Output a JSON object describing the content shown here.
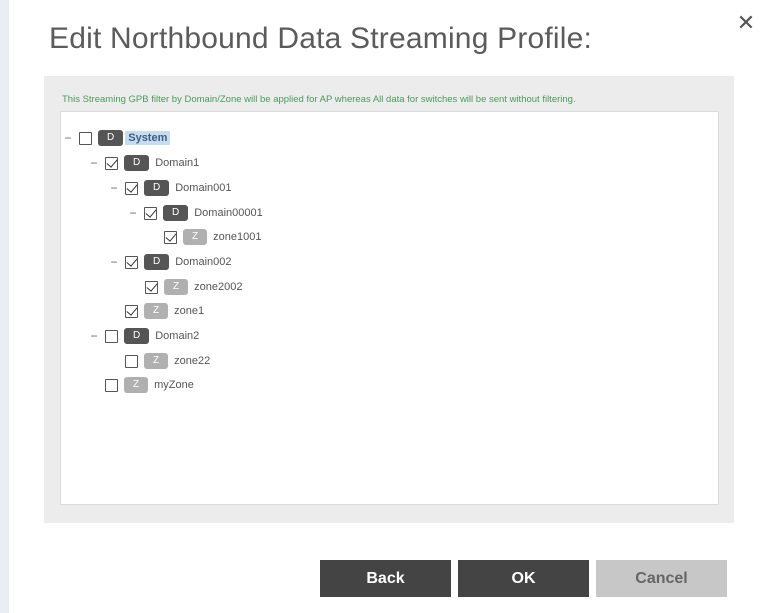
{
  "dialog": {
    "title": "Edit Northbound Data Streaming Profile:",
    "close_glyph": "✕"
  },
  "filter_note": "This Streaming GPB filter by Domain/Zone will be applied for AP whereas All data for switches will be sent without filtering.",
  "tree": {
    "system": {
      "badge": "D",
      "label": "System",
      "checked": false,
      "expander": "−"
    },
    "domain1": {
      "badge": "D",
      "label": "Domain1",
      "checked": true,
      "expander": "−"
    },
    "domain001": {
      "badge": "D",
      "label": "Domain001",
      "checked": true,
      "expander": "−"
    },
    "domain00001": {
      "badge": "D",
      "label": "Domain00001",
      "checked": true,
      "expander": "−"
    },
    "zone1001": {
      "badge": "Z",
      "label": "zone1001",
      "checked": true
    },
    "domain002": {
      "badge": "D",
      "label": "Domain002",
      "checked": true,
      "expander": "−"
    },
    "zone2002": {
      "badge": "Z",
      "label": "zone2002",
      "checked": true
    },
    "zone1": {
      "badge": "Z",
      "label": "zone1",
      "checked": true
    },
    "domain2": {
      "badge": "D",
      "label": "Domain2",
      "checked": false,
      "expander": "−"
    },
    "zone22": {
      "badge": "Z",
      "label": "zone22",
      "checked": false
    },
    "myzone": {
      "badge": "Z",
      "label": "myZone",
      "checked": false
    }
  },
  "buttons": {
    "back": "Back",
    "ok": "OK",
    "cancel": "Cancel"
  },
  "colors": {
    "note_text": "#4a9a5a",
    "domain_badge": "#555555",
    "zone_badge": "#b0b0b0",
    "selected_bg": "#c9dcec",
    "primary_button": "#444444",
    "disabled_button": "#c7c7c7"
  }
}
